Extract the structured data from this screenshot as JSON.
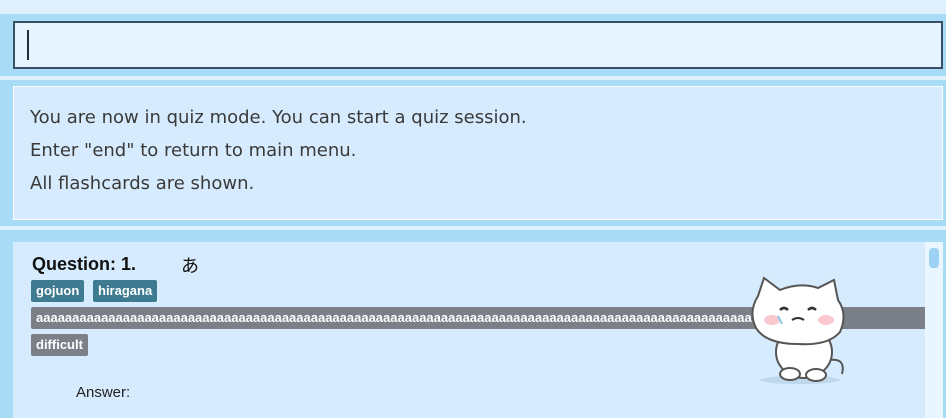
{
  "command_box": {
    "value": ""
  },
  "result_display": {
    "lines": [
      "You are now in quiz mode. You can start a quiz session.",
      "Enter \"end\" to return to main menu.",
      "All flashcards are shown."
    ]
  },
  "flashcard": {
    "question_label": "Question: 1.",
    "question_text": "あ",
    "categories": [
      "gojuon",
      "hiragana"
    ],
    "tags": [
      "aaaaaaaaaaaaaaaaaaaaaaaaaaaaaaaaaaaaaaaaaaaaaaaaaaaaaaaaaaaaaaaaaaaaaaaaaaaaaaaaaaaaaaaaaaaaaaaaaaaaaaaaaaaa",
      "difficult"
    ],
    "answer_label": "Answer:",
    "sticker_icon": "cat-sticker-icon"
  },
  "colors": {
    "background": "#a8dcf6",
    "panel": "#d6ebfd",
    "category_tag": "#3e7b91",
    "grey_tag": "#7b7f88"
  }
}
